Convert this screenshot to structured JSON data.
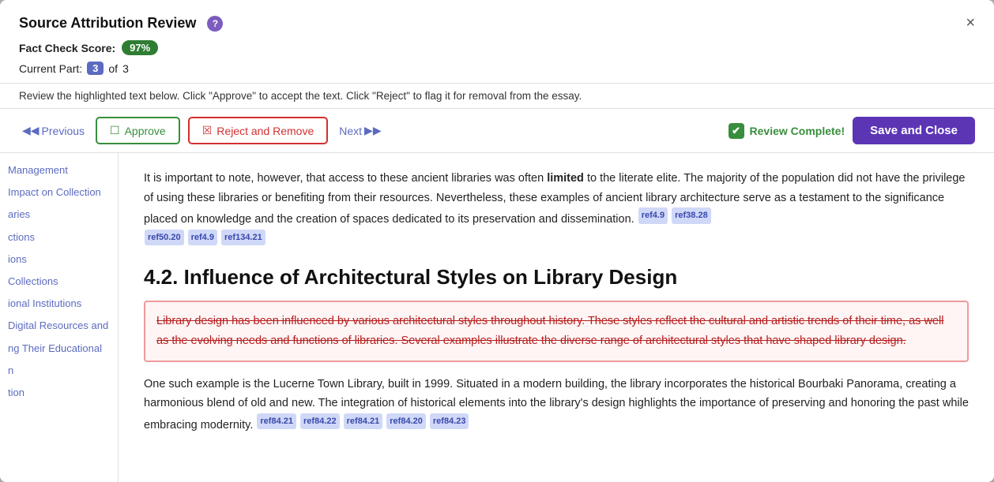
{
  "modal": {
    "title": "Source Attribution Review",
    "close_label": "×",
    "help_icon": "?"
  },
  "fact_check": {
    "label": "Fact Check Score:",
    "score": "97%"
  },
  "current_part": {
    "label": "Current Part:",
    "num": "3",
    "of": "of",
    "total": "3"
  },
  "instruction": "Review the highlighted text below. Click \"Approve\" to accept the text. Click \"Reject\" to flag it for removal from the essay.",
  "toolbar": {
    "previous_label": "Previous",
    "approve_label": "Approve",
    "reject_label": "Reject and Remove",
    "next_label": "Next",
    "review_complete_label": "Review Complete!",
    "save_label": "Save and Close"
  },
  "sidebar": {
    "items": [
      {
        "label": "Management",
        "active": false
      },
      {
        "label": "Impact on Collection",
        "active": false
      },
      {
        "label": "aries",
        "active": false
      },
      {
        "label": "ctions",
        "active": false
      },
      {
        "label": "ions",
        "active": false
      },
      {
        "label": "Collections",
        "active": false
      },
      {
        "label": "ional Institutions",
        "active": false
      },
      {
        "label": "Digital Resources and",
        "active": false
      },
      {
        "label": "ng Their Educational",
        "active": false
      },
      {
        "label": "n",
        "active": false
      },
      {
        "label": "tion",
        "active": false
      }
    ]
  },
  "content": {
    "para1": "It is important to note, however, that access to these ancient libraries was often limited to the literate elite. The majority of the population did not have the privilege of using these libraries or benefiting from their resources. Nevertheless, these examples of ancient library architecture serve as a testament to the significance placed on knowledge and the creation of spaces dedicated to its preservation and dissemination.",
    "para1_refs": [
      "ref4.9",
      "ref38.28",
      "ref50.20",
      "ref4.9",
      "ref134.21"
    ],
    "section_heading": "4.2. Influence of Architectural Styles on Library Design",
    "rejected_text": "Library design has been influenced by various architectural styles throughout history. These styles reflect the cultural and artistic trends of their time, as well as the evolving needs and functions of libraries. Several examples illustrate the diverse range of architectural styles that have shaped library design.",
    "para2": "One such example is the Lucerne Town Library, built in 1999. Situated in a modern building, the library incorporates the historical Bourbaki Panorama, creating a harmonious blend of old and new. The integration of historical elements into the library's design highlights the importance of preserving and honoring the past while embracing modernity.",
    "para2_refs": [
      "ref84.21",
      "ref84.22",
      "ref84.21",
      "ref84.20",
      "ref84.23"
    ]
  }
}
